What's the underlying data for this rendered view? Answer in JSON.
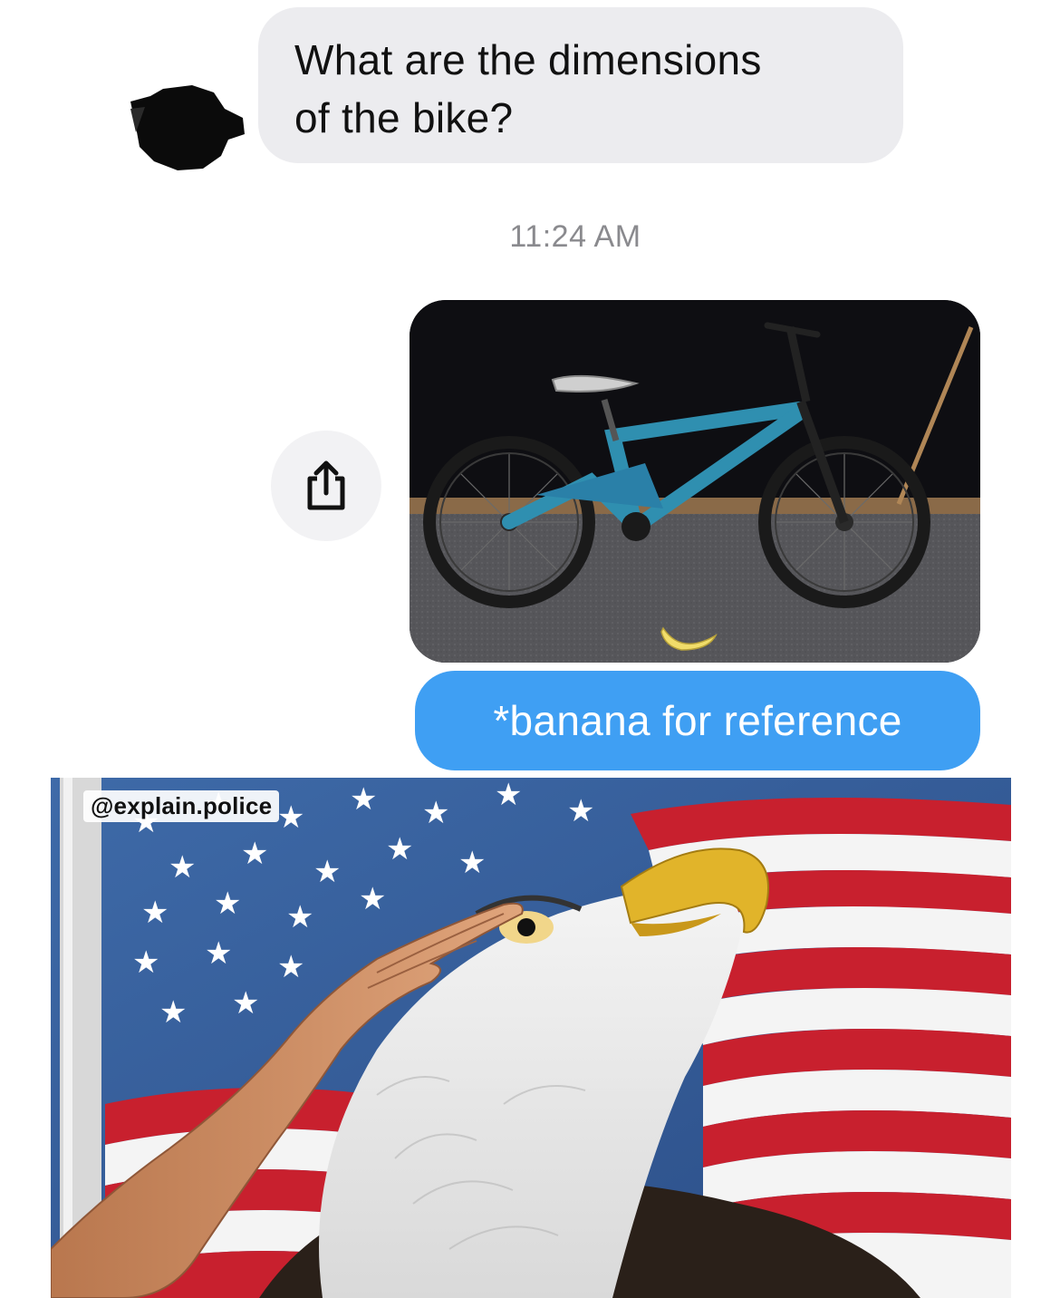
{
  "incoming_message": {
    "text": "What are the dimensions\nof the bike?"
  },
  "timestamp": "11:24 AM",
  "outgoing_photo": {
    "subject": "bicycle with banana on floor"
  },
  "outgoing_message": {
    "text": "*banana for reference"
  },
  "meme": {
    "watermark": "@explain.police",
    "subject": "bald eagle saluted by hand in front of american flag"
  },
  "icons": {
    "share": "share-icon",
    "avatar": "avatar"
  },
  "colors": {
    "incoming_bubble": "#ececef",
    "outgoing_bubble": "#3f9ff3",
    "timestamp": "#8a8a8e",
    "flag_red": "#c8202e",
    "flag_blue": "#2f4f8f"
  }
}
